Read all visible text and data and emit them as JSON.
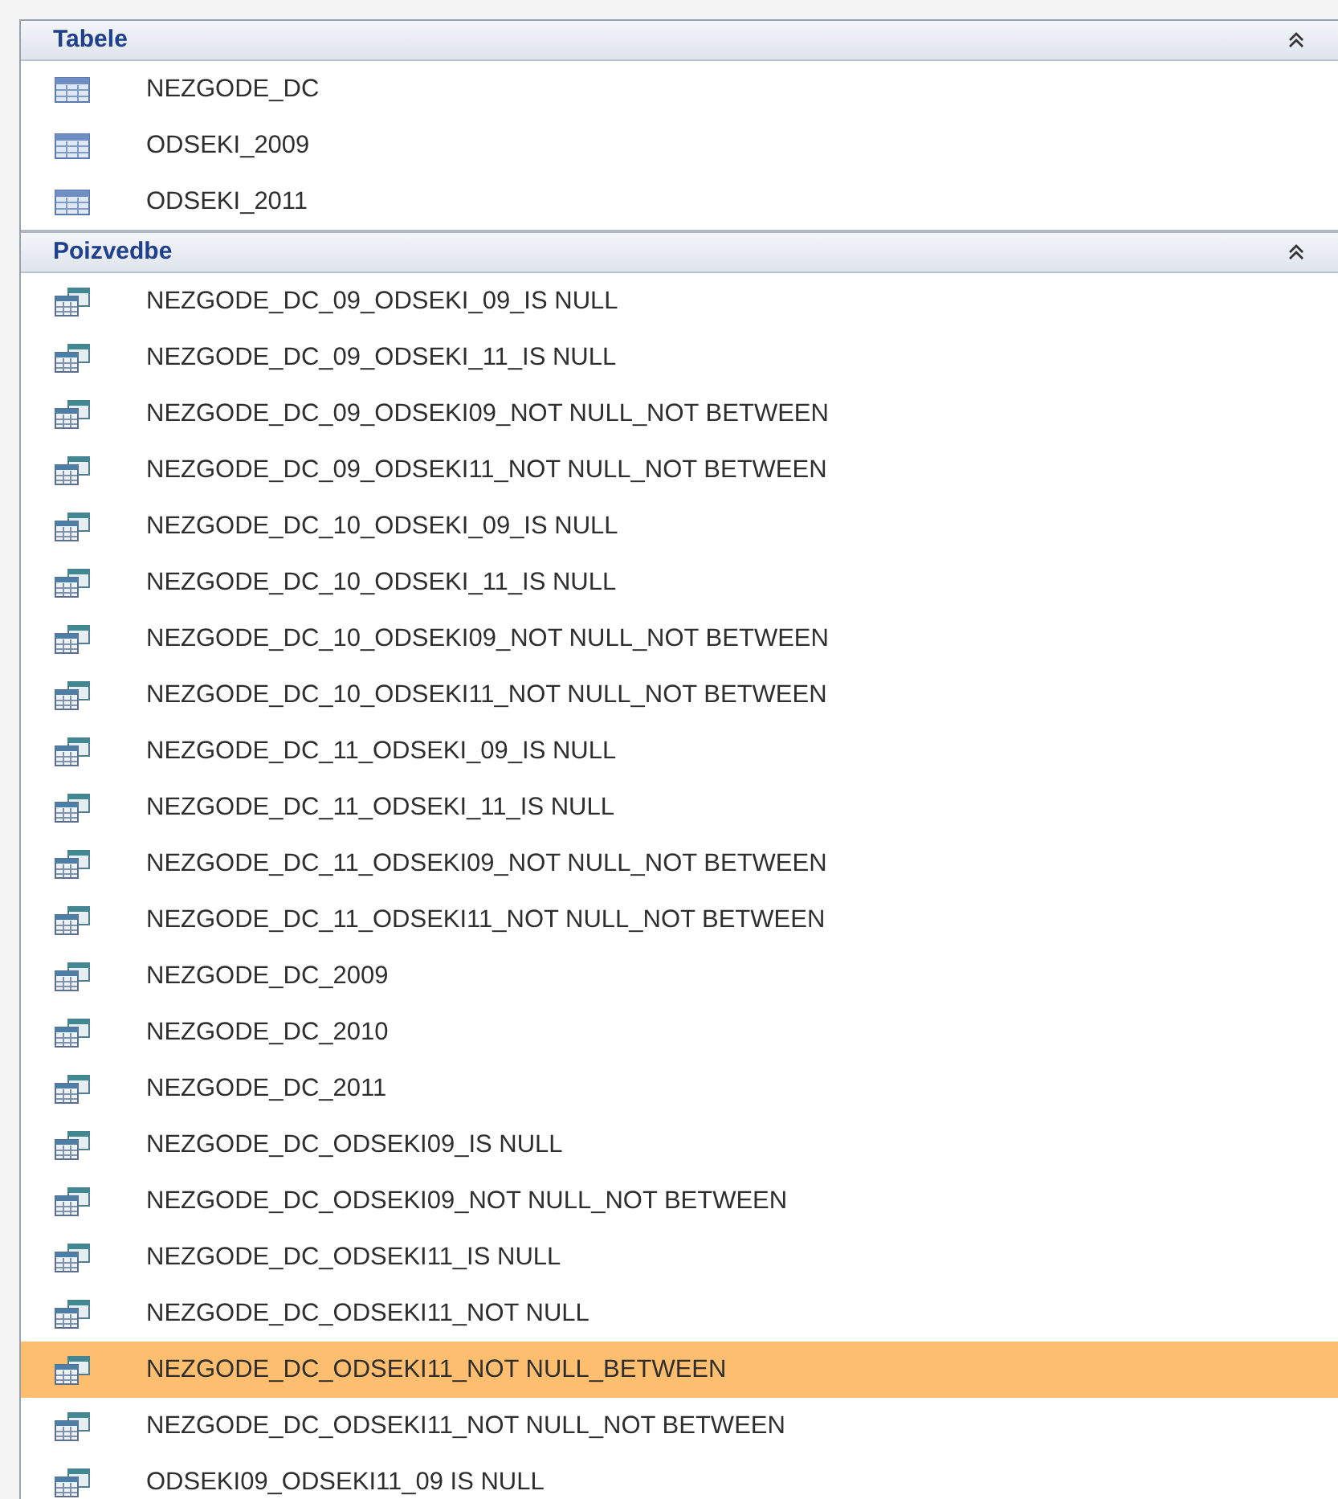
{
  "groups": [
    {
      "title": "Tabele",
      "expanded": true,
      "kind": "table",
      "items": [
        {
          "label": "NEZGODE_DC",
          "selected": false
        },
        {
          "label": "ODSEKI_2009",
          "selected": false
        },
        {
          "label": "ODSEKI_2011",
          "selected": false
        }
      ]
    },
    {
      "title": "Poizvedbe",
      "expanded": true,
      "kind": "query",
      "items": [
        {
          "label": "NEZGODE_DC_09_ODSEKI_09_IS NULL",
          "selected": false
        },
        {
          "label": "NEZGODE_DC_09_ODSEKI_11_IS NULL",
          "selected": false
        },
        {
          "label": "NEZGODE_DC_09_ODSEKI09_NOT NULL_NOT BETWEEN",
          "selected": false
        },
        {
          "label": "NEZGODE_DC_09_ODSEKI11_NOT NULL_NOT BETWEEN",
          "selected": false
        },
        {
          "label": "NEZGODE_DC_10_ODSEKI_09_IS NULL",
          "selected": false
        },
        {
          "label": "NEZGODE_DC_10_ODSEKI_11_IS NULL",
          "selected": false
        },
        {
          "label": "NEZGODE_DC_10_ODSEKI09_NOT NULL_NOT BETWEEN",
          "selected": false
        },
        {
          "label": "NEZGODE_DC_10_ODSEKI11_NOT NULL_NOT BETWEEN",
          "selected": false
        },
        {
          "label": "NEZGODE_DC_11_ODSEKI_09_IS NULL",
          "selected": false
        },
        {
          "label": "NEZGODE_DC_11_ODSEKI_11_IS NULL",
          "selected": false
        },
        {
          "label": "NEZGODE_DC_11_ODSEKI09_NOT NULL_NOT BETWEEN",
          "selected": false
        },
        {
          "label": "NEZGODE_DC_11_ODSEKI11_NOT NULL_NOT BETWEEN",
          "selected": false
        },
        {
          "label": "NEZGODE_DC_2009",
          "selected": false
        },
        {
          "label": "NEZGODE_DC_2010",
          "selected": false
        },
        {
          "label": "NEZGODE_DC_2011",
          "selected": false
        },
        {
          "label": "NEZGODE_DC_ODSEKI09_IS NULL",
          "selected": false
        },
        {
          "label": "NEZGODE_DC_ODSEKI09_NOT NULL_NOT BETWEEN",
          "selected": false
        },
        {
          "label": "NEZGODE_DC_ODSEKI11_IS NULL",
          "selected": false
        },
        {
          "label": "NEZGODE_DC_ODSEKI11_NOT NULL",
          "selected": false
        },
        {
          "label": "NEZGODE_DC_ODSEKI11_NOT NULL_BETWEEN",
          "selected": true
        },
        {
          "label": "NEZGODE_DC_ODSEKI11_NOT NULL_NOT BETWEEN",
          "selected": false
        },
        {
          "label": "ODSEKI09_ODSEKI11_09 IS NULL",
          "selected": false
        }
      ]
    }
  ]
}
